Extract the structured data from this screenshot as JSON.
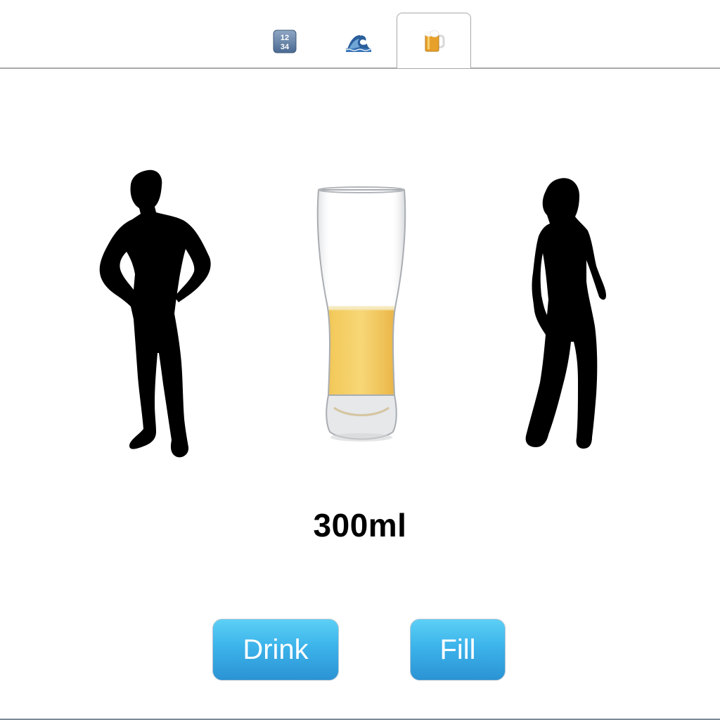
{
  "tabs": [
    {
      "icon": "numbers-icon",
      "label": "Numbers",
      "glyph_top": "12",
      "glyph_bottom": "34",
      "active": false
    },
    {
      "icon": "wave-icon",
      "label": "Wave",
      "active": false
    },
    {
      "icon": "beer-mug-icon",
      "label": "Beer",
      "active": true
    }
  ],
  "glass": {
    "fill_fraction": 0.42,
    "beer_color": "#e9b22a"
  },
  "volume_label": "300ml",
  "buttons": {
    "drink_label": "Drink",
    "fill_label": "Fill"
  },
  "colors": {
    "button_top": "#5cd0f6",
    "button_bottom": "#2b93d4",
    "button_text": "#ffffff"
  }
}
